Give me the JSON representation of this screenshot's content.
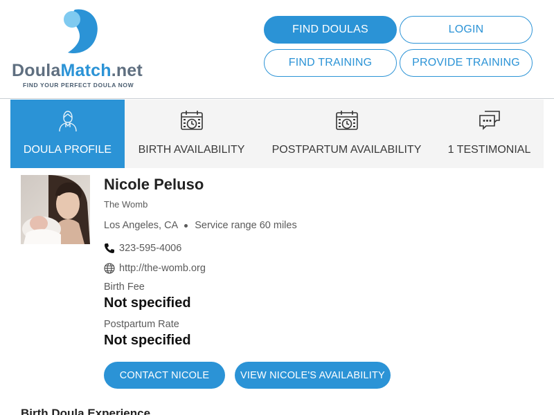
{
  "brand": {
    "name_part1": "Doula",
    "name_part2": "Match",
    "name_part3": ".net",
    "tagline": "FIND YOUR PERFECT DOULA NOW",
    "accent_color": "#2b93d6"
  },
  "nav": {
    "find_doulas": "FIND DOULAS",
    "login": "LOGIN",
    "find_training": "FIND TRAINING",
    "provide_training": "PROVIDE TRAINING"
  },
  "tabs": [
    {
      "label": "DOULA PROFILE",
      "icon": "doula-person-icon",
      "active": true
    },
    {
      "label": "BIRTH AVAILABILITY",
      "icon": "calendar-clock-icon",
      "active": false
    },
    {
      "label": "POSTPARTUM AVAILABILITY",
      "icon": "calendar-clock-icon",
      "active": false
    },
    {
      "label": "1 TESTIMONIAL",
      "icon": "chat-bubbles-icon",
      "active": false
    }
  ],
  "profile": {
    "name": "Nicole Peluso",
    "business": "The Womb",
    "location": "Los Angeles, CA",
    "service_range": "Service range 60 miles",
    "phone": "323-595-4006",
    "website": "http://the-womb.org",
    "birth_fee_label": "Birth Fee",
    "birth_fee_value": "Not specified",
    "postpartum_rate_label": "Postpartum Rate",
    "postpartum_rate_value": "Not specified"
  },
  "actions": {
    "contact": "CONTACT NICOLE",
    "availability": "VIEW NICOLE'S AVAILABILITY"
  },
  "sections": {
    "experience_heading": "Birth Doula Experience"
  }
}
